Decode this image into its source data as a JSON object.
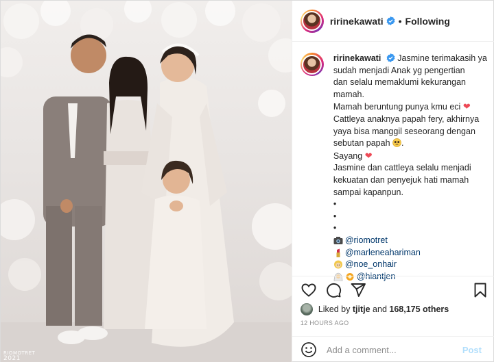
{
  "post": {
    "username": "ririnekawati",
    "follow_status": "Following",
    "separator": "•"
  },
  "caption": {
    "lines": [
      "Jasmine terimakasih ya",
      "sudah menjadi Anak yg pengertian",
      "dan selalu memaklumi kekurangan",
      "mamah.",
      "Mamah beruntung punya kmu eci",
      "Cattleya anaknya papah fery, akhirnya",
      "yaya bisa manggil seseorang dengan",
      "sebutan papah",
      "Sayang",
      "Jasmine dan cattleya selalu menjadi",
      "kekuatan dan penyejuk hati mamah",
      "sampai kapanpun.",
      "•",
      "•",
      "•"
    ],
    "period": ".",
    "credits": [
      {
        "icon": "camera-icon",
        "handle": "@riomotret"
      },
      {
        "icon": "lipstick-icon",
        "handle": "@marleneahariman"
      },
      {
        "icon": "hair-icon",
        "handle": "@noe_onhair"
      },
      {
        "icon": "bride-icon",
        "handle": "@hiantjen"
      }
    ]
  },
  "likes": {
    "prefix": "Liked by",
    "liker": "tjitje",
    "middle": "and",
    "count": "168,175 others"
  },
  "timestamp": "12 HOURS AGO",
  "comment": {
    "placeholder": "Add a comment...",
    "post_label": "Post"
  },
  "watermark": {
    "brand": "RIOMOTRET",
    "year": "2021"
  },
  "colors": {
    "heart": "#ed4956",
    "link": "#00376b",
    "post_disabled": "#b2dffc",
    "verified": "#3897f0"
  }
}
